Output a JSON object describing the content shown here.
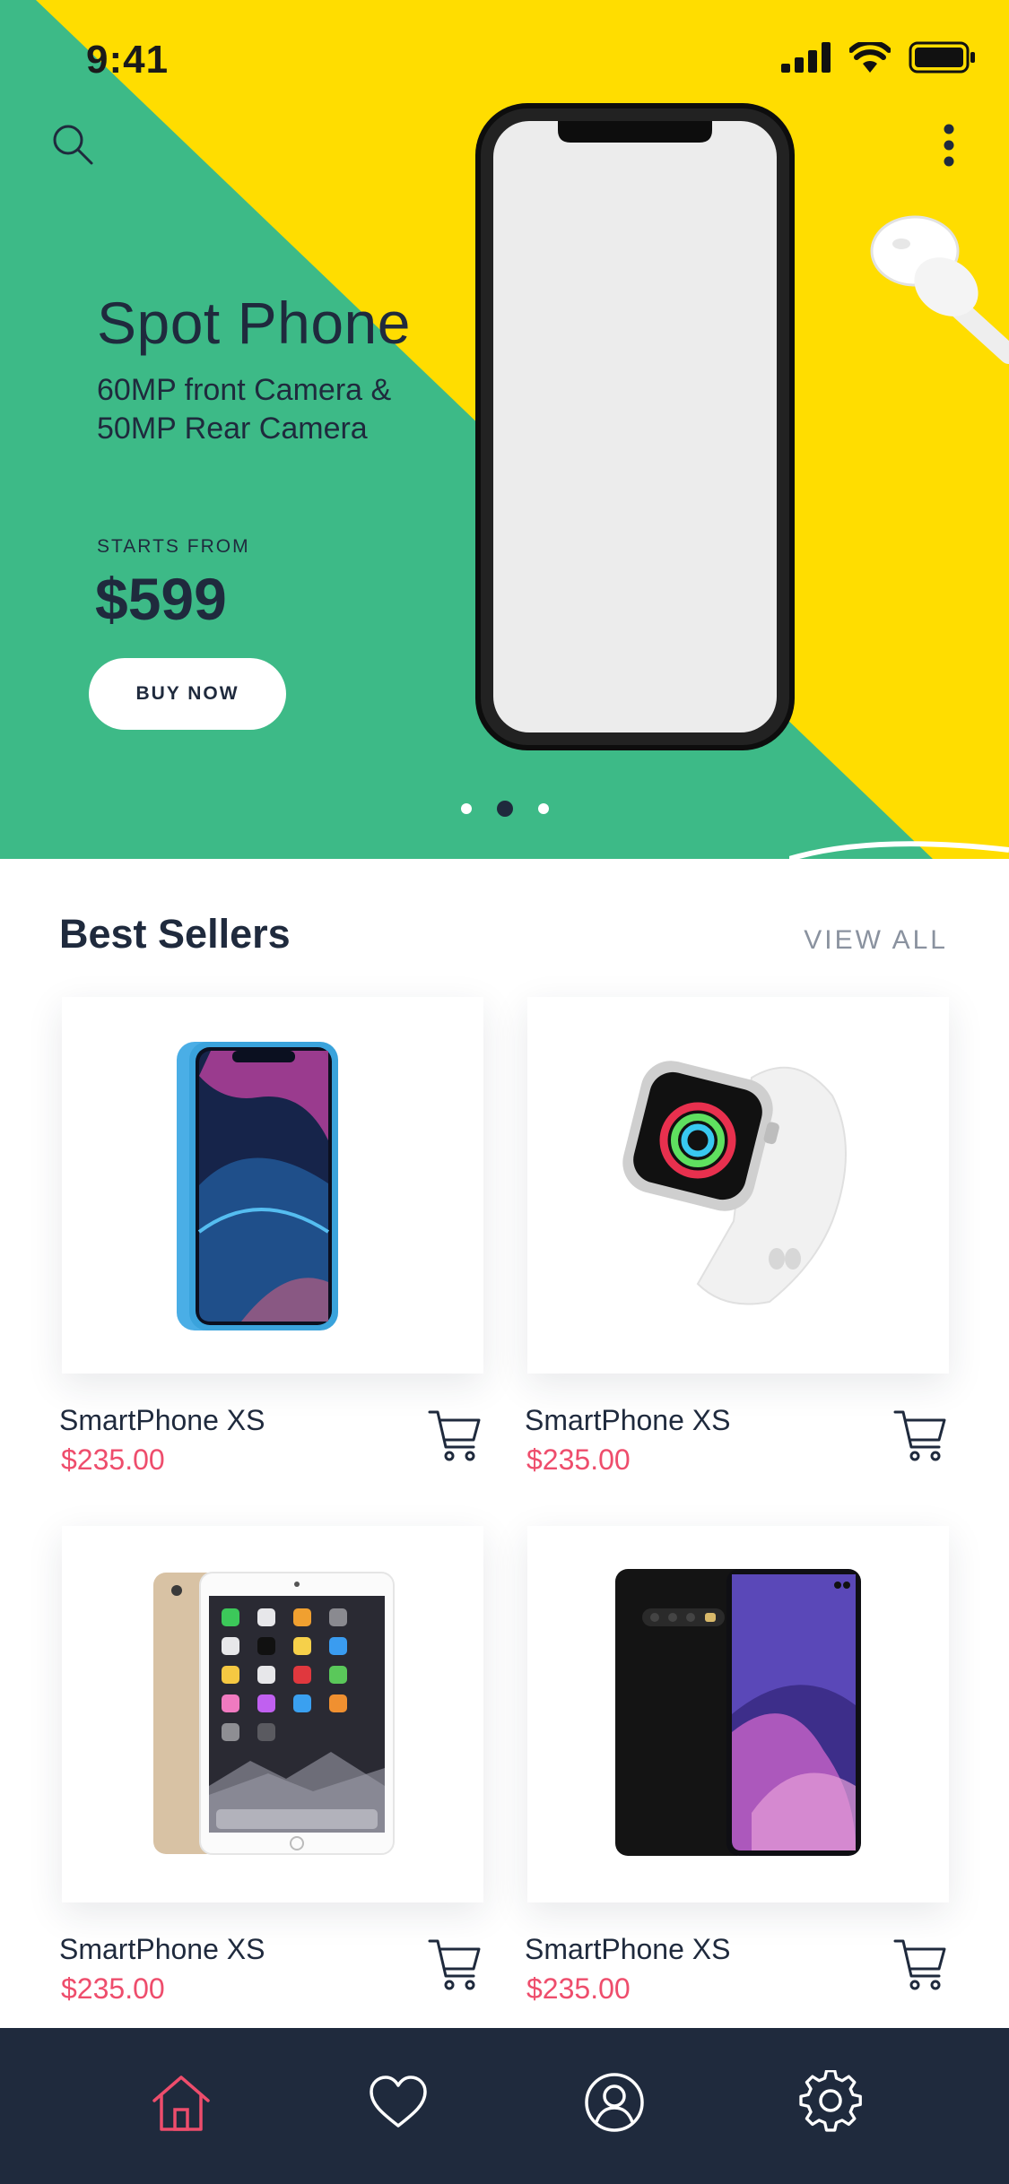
{
  "status_bar": {
    "time": "9:41"
  },
  "hero": {
    "title": "Spot Phone",
    "subtitle_line1": "60MP front Camera &",
    "subtitle_line2": "50MP Rear Camera",
    "starts_label": "STARTS FROM",
    "price": "$599",
    "cta_label": "BUY NOW",
    "carousel": {
      "count": 3,
      "active_index": 1
    },
    "colors": {
      "yellow": "#ffdd00",
      "green": "#3dba87",
      "ink": "#1f2a3d"
    }
  },
  "best_sellers": {
    "title": "Best Sellers",
    "view_all": "VIEW ALL",
    "products": [
      {
        "name": "SmartPhone XS",
        "price": "$235.00",
        "image": "blue-smartphone-icon"
      },
      {
        "name": "SmartPhone XS",
        "price": "$235.00",
        "image": "smartwatch-icon"
      },
      {
        "name": "SmartPhone XS",
        "price": "$235.00",
        "image": "gold-tablet-icon"
      },
      {
        "name": "SmartPhone XS",
        "price": "$235.00",
        "image": "black-smartphone-icon"
      }
    ],
    "colors": {
      "price": "#ee4d6c"
    }
  },
  "bottom_nav": {
    "items": [
      {
        "icon": "home-icon",
        "active": true
      },
      {
        "icon": "heart-icon",
        "active": false
      },
      {
        "icon": "profile-icon",
        "active": false
      },
      {
        "icon": "settings-icon",
        "active": false
      }
    ],
    "colors": {
      "background": "#1f2a3d",
      "active": "#ee4d6c",
      "inactive": "#ffffff"
    }
  }
}
